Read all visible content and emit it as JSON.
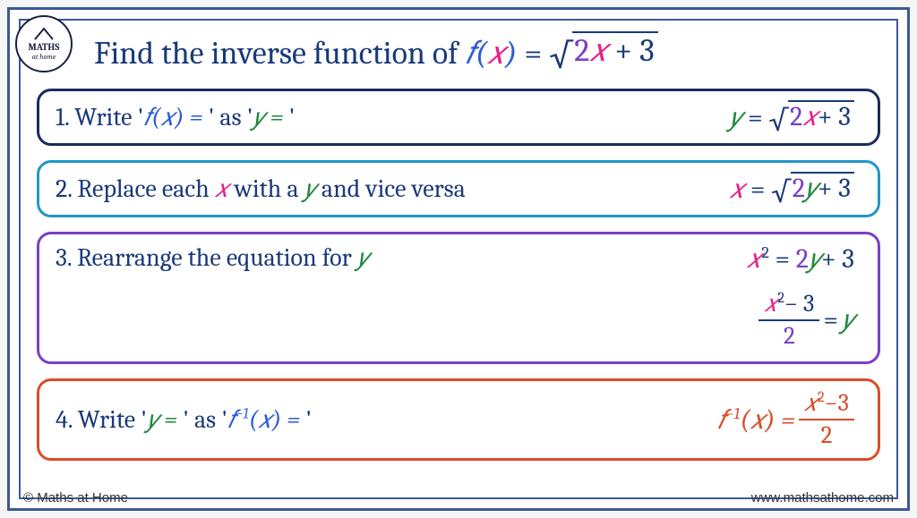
{
  "logo": {
    "line1": "MATHS",
    "line2": "at home"
  },
  "title": {
    "prefix": "Find the inverse function of ",
    "fx": "𝑓(𝑥)",
    "eq": " = ",
    "inside1": "2",
    "inside1x": "𝑥",
    "plus": " + 3"
  },
  "steps": {
    "s1": {
      "num": "1. ",
      "a": "Write ",
      "fx": "𝑓(𝑥) = ",
      "b": " as ",
      "y": "𝑦 = ",
      "eq_y": "𝑦 ",
      "eq_eq": " = ",
      "eq_two": "2",
      "eq_x": "𝑥",
      "eq_tail": "+ 3"
    },
    "s2": {
      "num": "2. ",
      "a": "Replace each ",
      "x": "𝑥",
      "b": " with a ",
      "y": "𝑦",
      "c": " and vice versa",
      "eq_x": "𝑥 ",
      "eq_eq": " = ",
      "eq_two": "2",
      "eq_y": "𝑦",
      "eq_tail": "+ 3"
    },
    "s3": {
      "num": "3. ",
      "a": "Rearrange the equation for ",
      "y": "𝑦",
      "l1_x": "𝑥",
      "l1_sq": "2",
      "l1_eq": " = ",
      "l1_2": "2",
      "l1_y": "𝑦",
      "l1_tail": "+ 3",
      "l2_x": "𝑥",
      "l2_sq": "2",
      "l2_minus3": "− 3",
      "l2_den": "2",
      "l2_eq": " = ",
      "l2_y": "𝑦"
    },
    "s4": {
      "num": "4. ",
      "a": "Write ",
      "yq": "𝑦 = ",
      "b": " as ",
      "finv": "𝑓",
      "finv_sup": "−1",
      "finv_x": "(𝑥) = ",
      "eq_f": "𝑓",
      "eq_sup": "−1",
      "eq_px": "(𝑥) = ",
      "eq_x": "𝑥",
      "eq_sq": "2",
      "eq_m3": "−3",
      "eq_den": "2"
    }
  },
  "footer": {
    "left": "© Maths at Home",
    "right": "www.mathsathome.com"
  },
  "quote": "'",
  "sqrt_symbol": "√"
}
